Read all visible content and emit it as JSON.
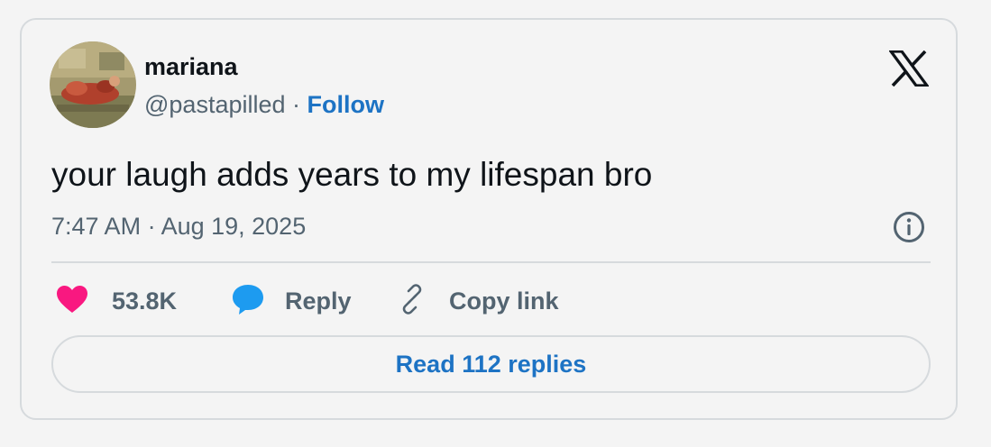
{
  "author": {
    "name": "mariana",
    "handle": "@pastapilled",
    "separator": " · ",
    "follow_label": "Follow"
  },
  "tweet": {
    "text": "your laugh adds years to my lifespan bro",
    "timestamp": "7:47 AM · Aug 19, 2025"
  },
  "actions": {
    "likes_count": "53.8K",
    "reply_label": "Reply",
    "copy_link_label": "Copy link"
  },
  "read_replies_label": "Read 112 replies",
  "icons": {
    "brand": "x-logo-icon",
    "info": "info-icon",
    "like": "heart-icon",
    "reply": "speech-bubble-icon",
    "copy": "link-icon"
  },
  "colors": {
    "link_blue": "#1d73c4",
    "heart_pink": "#f91880",
    "reply_blue": "#1d9bf0",
    "text_dark": "#0f1419",
    "text_gray": "#536471",
    "border": "#d6dadd",
    "background": "#f4f4f4"
  }
}
